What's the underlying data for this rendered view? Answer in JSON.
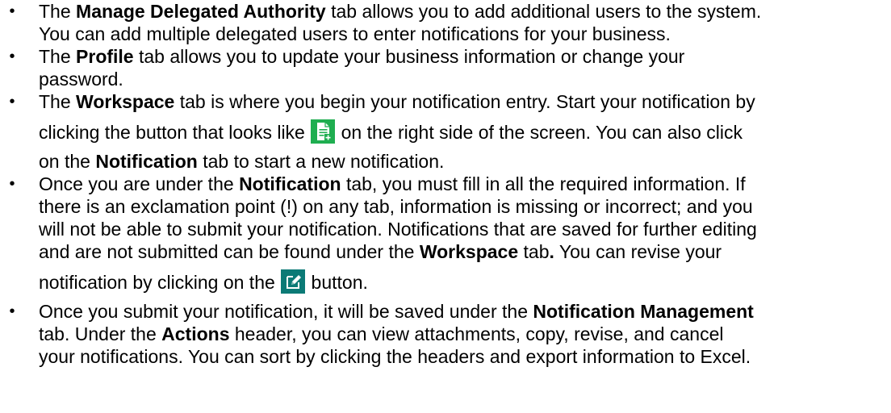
{
  "icons": {
    "new_notification": "new-document-icon",
    "revise": "edit-pencil-icon"
  },
  "colors": {
    "icon_green": "#1fae50",
    "icon_teal": "#0b7a76"
  },
  "bullet_char": "•",
  "items": [
    {
      "l1_a": "The ",
      "l1_b": "Manage Delegated Authority",
      "l1_c": " tab allows you to add additional users to the system.",
      "l2": "You can add multiple delegated users to enter notifications for your business."
    },
    {
      "l1_a": "The ",
      "l1_b": "Profile",
      "l1_c": " tab allows you to update your business information or change your",
      "l2": "password."
    },
    {
      "l1_a": "The ",
      "l1_b": "Workspace",
      "l1_c": " tab is where you begin your notification entry.  Start your notification by",
      "l2_a": "clicking the button that looks like ",
      "l2_b": " on the right side of the screen.  You can also click",
      "l3_a": "on the ",
      "l3_b": "Notification",
      "l3_c": " tab to start a new notification."
    },
    {
      "l1_a": "Once you are under the ",
      "l1_b": "Notification",
      "l1_c": " tab, you must fill in all the required information.  If",
      "l2": "there is an exclamation point (!) on any tab, information is missing or incorrect; and you",
      "l3": "will not be able to submit your notification.  Notifications that are saved for further editing",
      "l4_a": "and are not submitted can be found under the ",
      "l4_b": "Workspace",
      "l4_c": " tab",
      "l4_d": ".",
      "l4_e": "  You can revise your",
      "l5_a": "notification by clicking on the ",
      "l5_b": " button."
    },
    {
      "l1_a": "Once you submit your notification, it will be saved under the ",
      "l1_b": "Notification Management",
      "l2_a": "tab.  Under the ",
      "l2_b": "Actions",
      "l2_c": " header, you can view attachments, copy, revise, and cancel",
      "l3": "your notifications.  You can sort by clicking the headers and export information to Excel."
    }
  ]
}
